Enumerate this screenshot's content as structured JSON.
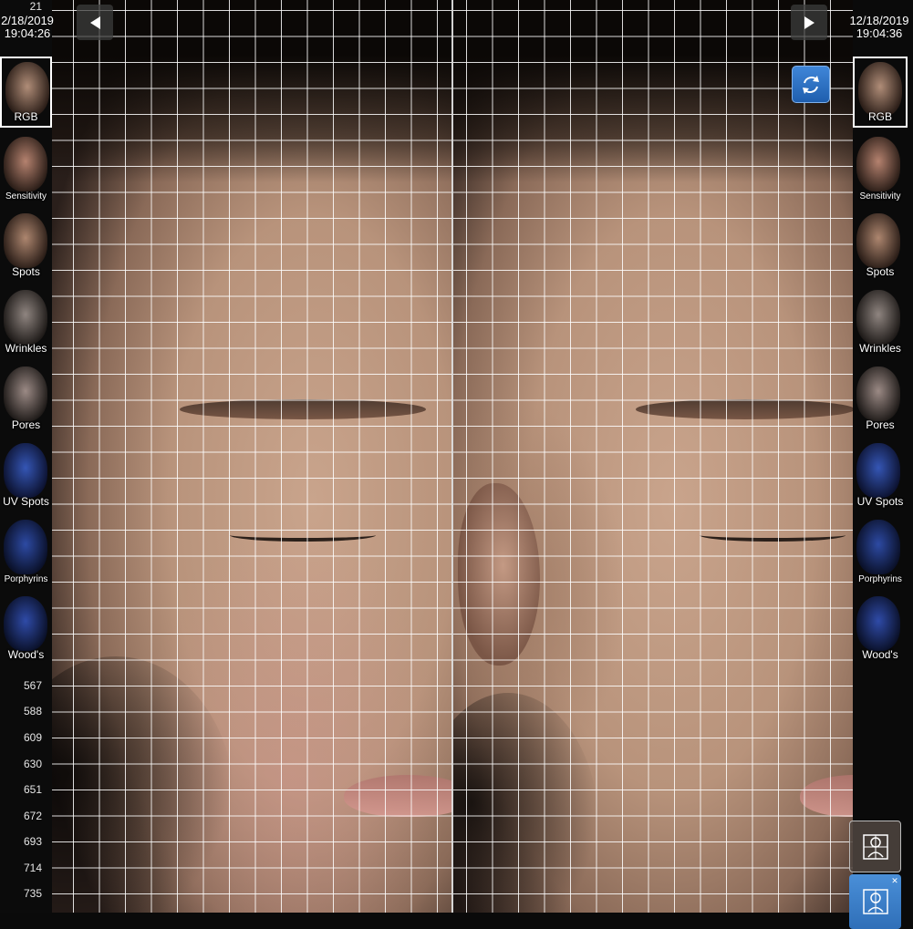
{
  "left_panel": {
    "date": "2/18/2019",
    "time": "19:04:26"
  },
  "right_panel": {
    "date": "12/18/2019",
    "time": "19:04:36"
  },
  "ruler": {
    "top_label": "21",
    "bottom_ticks": [
      "567",
      "588",
      "609",
      "630",
      "651",
      "672",
      "693",
      "714",
      "735"
    ]
  },
  "thumbnails": [
    {
      "label": "RGB",
      "selected": true,
      "tint": "#b08d78"
    },
    {
      "label": "Sensitivity",
      "selected": false,
      "tint": "#b5826f"
    },
    {
      "label": "Spots",
      "selected": false,
      "tint": "#ad866f"
    },
    {
      "label": "Wrinkles",
      "selected": false,
      "tint": "#8f8580"
    },
    {
      "label": "Pores",
      "selected": false,
      "tint": "#9b8a85"
    },
    {
      "label": "UV Spots",
      "selected": false,
      "tint": "#3556b5"
    },
    {
      "label": "Porphyrins",
      "selected": false,
      "tint": "#2d4aa3"
    },
    {
      "label": "Wood's",
      "selected": false,
      "tint": "#2f4ba8"
    }
  ],
  "buttons": {
    "prev_icon": "triangle-left-icon",
    "next_icon": "triangle-right-icon",
    "sync_icon": "refresh-icon",
    "compare_icon": "face-compare-icon",
    "active_tool_icon": "face-split-icon"
  },
  "colors": {
    "accent": "#2f74c6",
    "grid": "#ffffff",
    "background": "#0a0a0a"
  }
}
